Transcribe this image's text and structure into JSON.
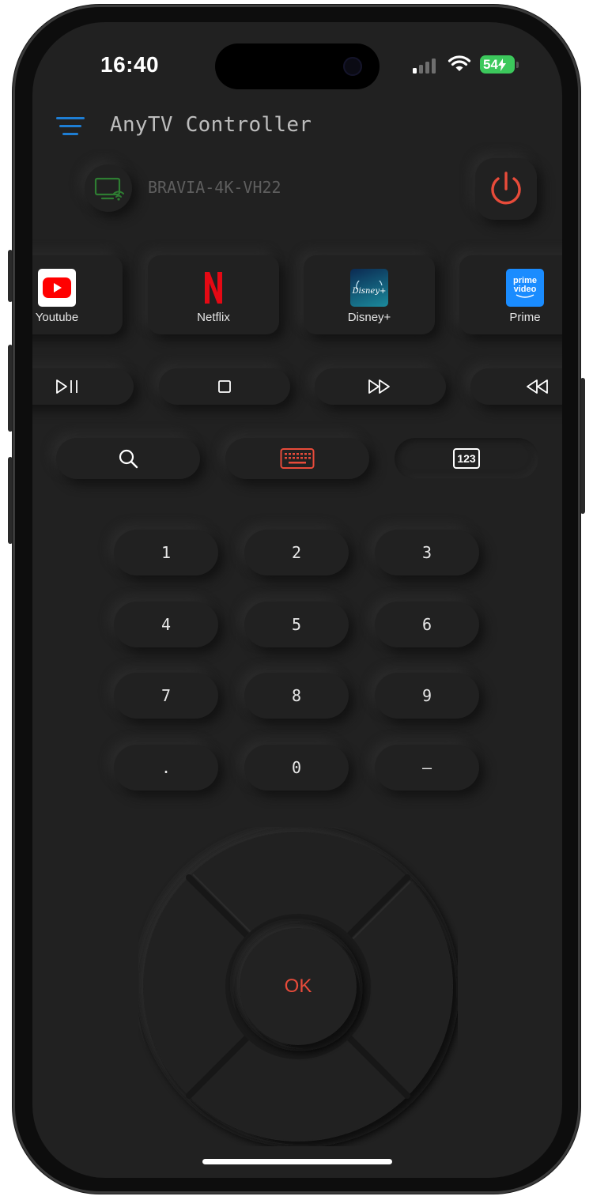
{
  "status_bar": {
    "time": "16:40",
    "battery": "54"
  },
  "header": {
    "title": "AnyTV Controller"
  },
  "device": {
    "name": "BRAVIA-4K-VH22"
  },
  "apps": [
    {
      "label": "Youtube",
      "icon": "youtube-logo"
    },
    {
      "label": "Netflix",
      "icon": "netflix-logo"
    },
    {
      "label": "Disney+",
      "icon": "disney-plus-logo",
      "logo_text": "Disney+"
    },
    {
      "label": "Prime",
      "icon": "prime-video-logo",
      "logo_line1": "prime",
      "logo_line2": "video"
    }
  ],
  "media_controls": [
    "play-pause-icon",
    "stop-icon",
    "fast-forward-icon",
    "rewind-icon"
  ],
  "tools": [
    {
      "icon": "search-icon",
      "active": false
    },
    {
      "icon": "keyboard-icon",
      "active": true
    },
    {
      "icon": "numpad-icon",
      "label": "123",
      "active": false
    }
  ],
  "keypad": [
    "1",
    "2",
    "3",
    "4",
    "5",
    "6",
    "7",
    "8",
    "9",
    ".",
    "0",
    "–"
  ],
  "dpad": {
    "ok_label": "OK"
  },
  "colors": {
    "background": "#212121",
    "accent_red": "#e84b3a",
    "menu_blue": "#1e7ed4",
    "device_green": "#2e7d32"
  }
}
